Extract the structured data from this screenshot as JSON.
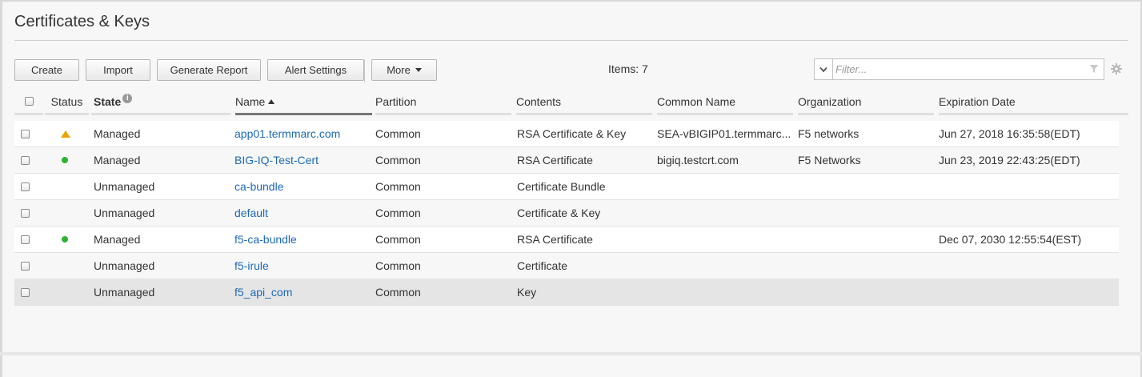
{
  "page": {
    "title": "Certificates & Keys"
  },
  "toolbar": {
    "create_label": "Create",
    "import_label": "Import",
    "generate_report_label": "Generate Report",
    "alert_settings_label": "Alert Settings",
    "more_label": "More"
  },
  "items_text": "Items: 7",
  "filter": {
    "placeholder": "Filter...",
    "value": ""
  },
  "icons": {
    "filter_dropdown": "chevron-down-icon",
    "filter_funnel": "funnel-icon",
    "settings": "gear-icon",
    "state_info": "info-icon",
    "status_warning": "warning-triangle-icon",
    "status_ok": "green-dot-icon"
  },
  "colors": {
    "link": "#1c69b8",
    "warning": "#e8a400",
    "ok": "#2db331"
  },
  "columns": {
    "status": "Status",
    "state": "State",
    "name": "Name",
    "partition": "Partition",
    "contents": "Contents",
    "common_name": "Common Name",
    "organization": "Organization",
    "expiration": "Expiration Date"
  },
  "sort": {
    "column": "name",
    "direction": "ascending"
  },
  "rows": [
    {
      "status": "warning",
      "state": "Managed",
      "name": "app01.termmarc.com",
      "partition": "Common",
      "contents": "RSA Certificate & Key",
      "common_name": "SEA-vBIGIP01.termmarc...",
      "organization": "F5 networks",
      "expiration": "Jun 27, 2018 16:35:58(EDT)"
    },
    {
      "status": "ok",
      "state": "Managed",
      "name": "BIG-IQ-Test-Cert",
      "partition": "Common",
      "contents": "RSA Certificate",
      "common_name": "bigiq.testcrt.com",
      "organization": "F5 Networks",
      "expiration": "Jun 23, 2019 22:43:25(EDT)"
    },
    {
      "status": "",
      "state": "Unmanaged",
      "name": "ca-bundle",
      "partition": "Common",
      "contents": "Certificate Bundle",
      "common_name": "",
      "organization": "",
      "expiration": ""
    },
    {
      "status": "",
      "state": "Unmanaged",
      "name": "default",
      "partition": "Common",
      "contents": "Certificate & Key",
      "common_name": "",
      "organization": "",
      "expiration": ""
    },
    {
      "status": "ok",
      "state": "Managed",
      "name": "f5-ca-bundle",
      "partition": "Common",
      "contents": "RSA Certificate",
      "common_name": "",
      "organization": "",
      "expiration": "Dec 07, 2030 12:55:54(EST)"
    },
    {
      "status": "",
      "state": "Unmanaged",
      "name": "f5-irule",
      "partition": "Common",
      "contents": "Certificate",
      "common_name": "",
      "organization": "",
      "expiration": ""
    },
    {
      "status": "",
      "state": "Unmanaged",
      "name": "f5_api_com",
      "partition": "Common",
      "contents": "Key",
      "common_name": "",
      "organization": "",
      "expiration": ""
    }
  ]
}
